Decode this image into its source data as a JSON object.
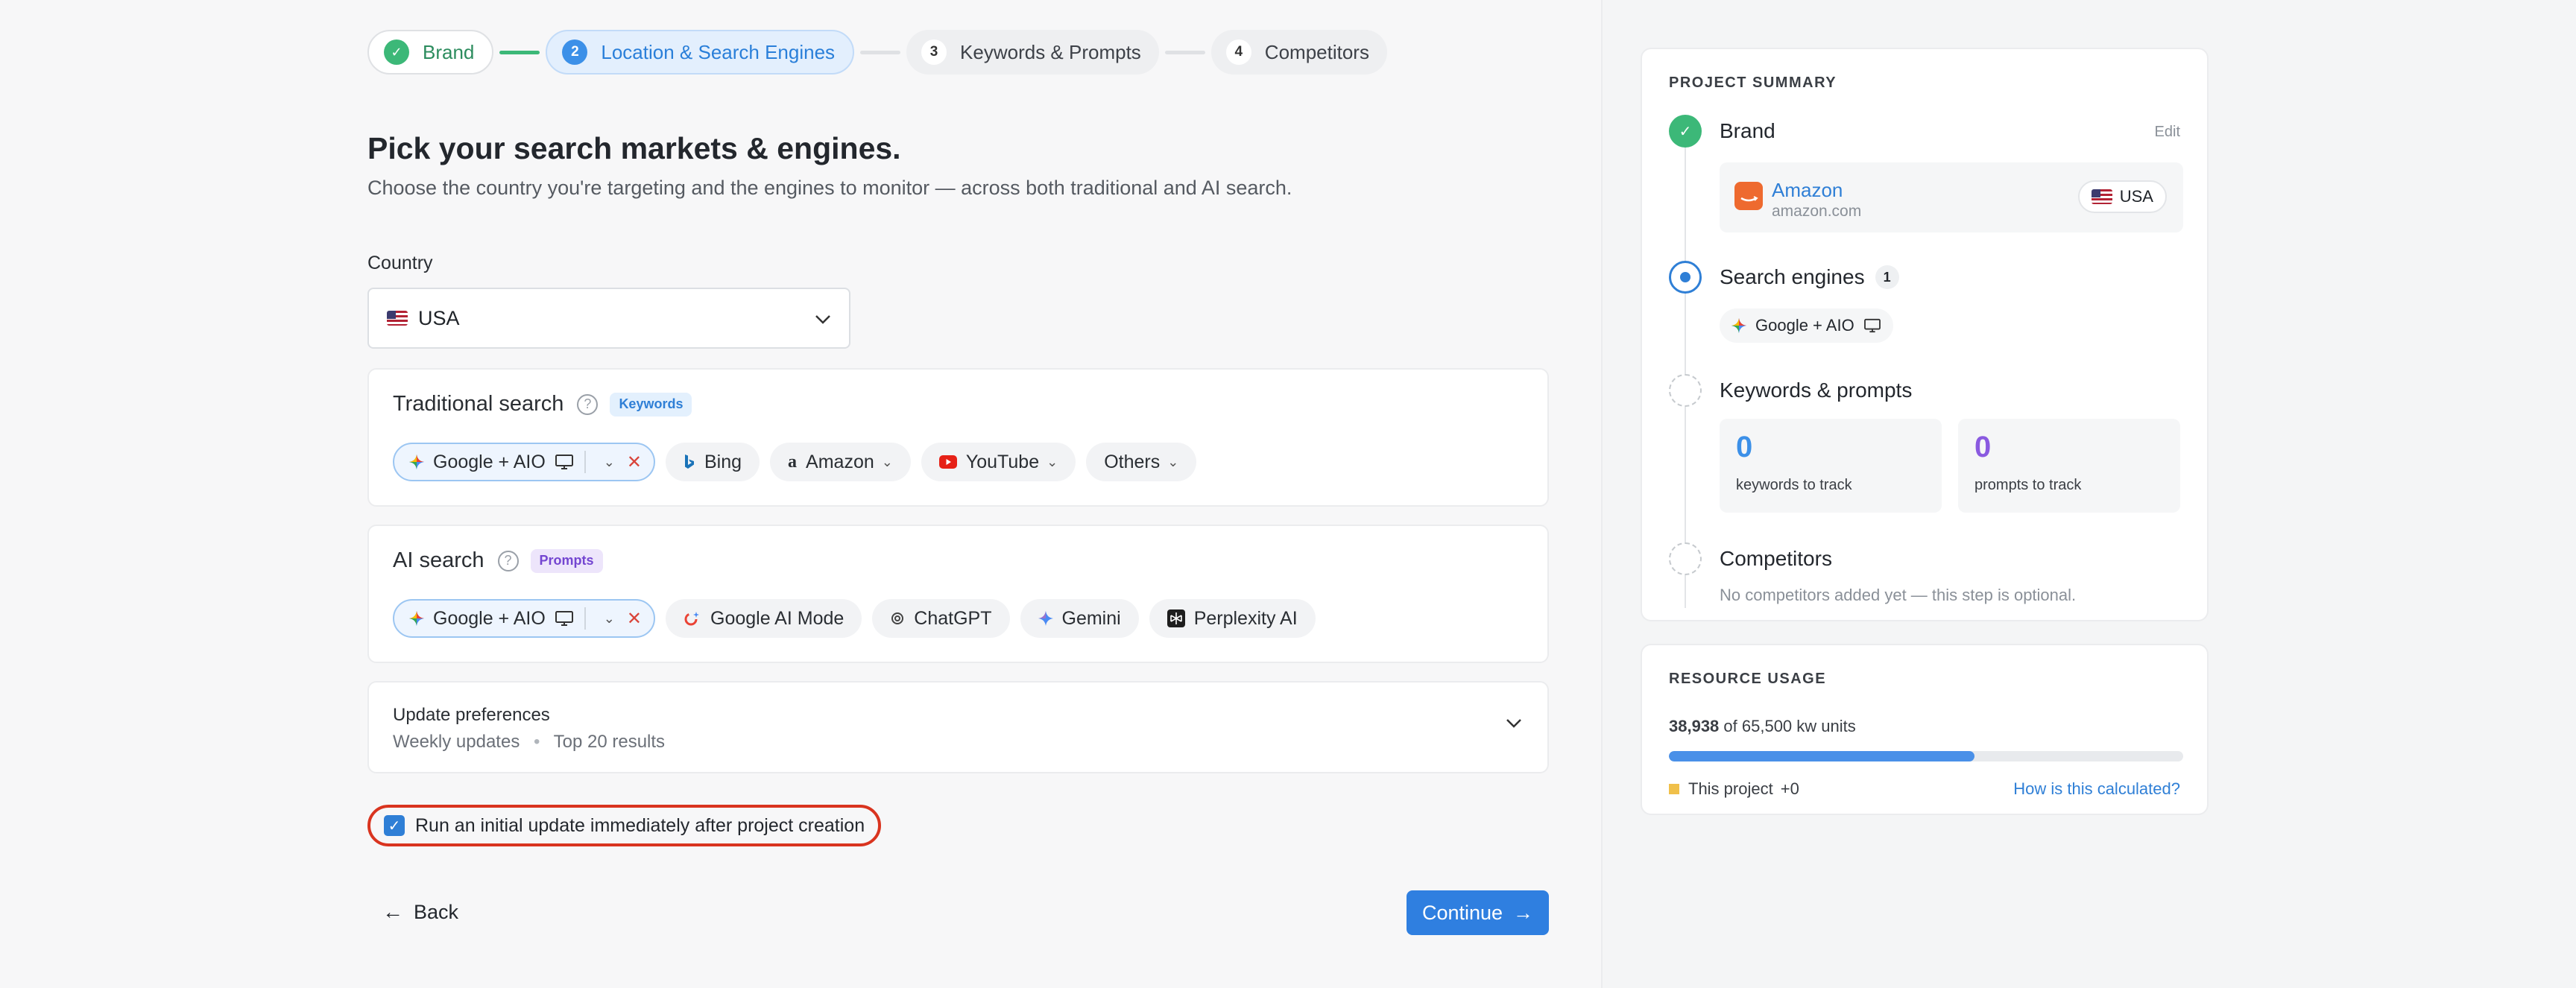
{
  "stepper": {
    "steps": [
      {
        "num": "✓",
        "label": "Brand"
      },
      {
        "num": "2",
        "label": "Location & Search Engines"
      },
      {
        "num": "3",
        "label": "Keywords & Prompts"
      },
      {
        "num": "4",
        "label": "Competitors"
      }
    ]
  },
  "header": {
    "title": "Pick your search markets & engines.",
    "subtitle": "Choose the country you're targeting and the engines to monitor — across both traditional and AI search."
  },
  "country": {
    "label": "Country",
    "value": "USA"
  },
  "traditional": {
    "title": "Traditional search",
    "tag": "Keywords",
    "selected": "Google + AIO",
    "options": [
      "Bing",
      "Amazon",
      "YouTube",
      "Others"
    ]
  },
  "ai": {
    "title": "AI search",
    "tag": "Prompts",
    "selected": "Google + AIO",
    "options": [
      "Google AI Mode",
      "ChatGPT",
      "Gemini",
      "Perplexity AI"
    ]
  },
  "preferences": {
    "title": "Update preferences",
    "frequency": "Weekly updates",
    "results": "Top 20 results"
  },
  "initial_update": {
    "label": "Run an initial update immediately after project creation",
    "checked": true
  },
  "nav": {
    "back": "Back",
    "continue": "Continue"
  },
  "summary": {
    "heading": "PROJECT SUMMARY",
    "brand": {
      "title": "Brand",
      "edit": "Edit",
      "name": "Amazon",
      "domain": "amazon.com",
      "country": "USA"
    },
    "engines": {
      "title": "Search engines",
      "count": "1",
      "engine": "Google + AIO"
    },
    "keywords": {
      "title": "Keywords & prompts",
      "keywords_count": "0",
      "keywords_label": "keywords to track",
      "prompts_count": "0",
      "prompts_label": "prompts to track"
    },
    "competitors": {
      "title": "Competitors",
      "note": "No competitors added yet — this step is optional."
    }
  },
  "resources": {
    "heading": "RESOURCE USAGE",
    "used": "38,938",
    "total_text": "of 65,500 kw units",
    "fill_fraction": 0.5945,
    "project_label": "This project",
    "project_delta": "+0",
    "how_link": "How is this calculated?"
  },
  "colors": {
    "accent": "#2f7fe0",
    "success": "#3cb878",
    "danger": "#d9341f",
    "purple": "#7446d1"
  }
}
